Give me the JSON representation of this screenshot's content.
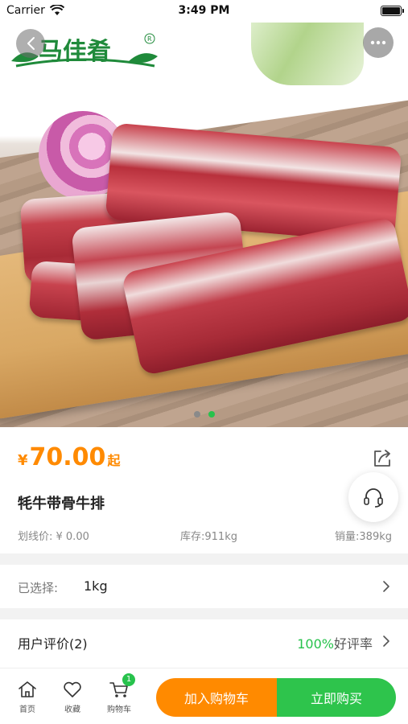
{
  "status_bar": {
    "carrier": "Carrier",
    "time": "3:49 PM"
  },
  "hero": {
    "brand_logo_text": "马佳肴",
    "brand_registered_mark": "R",
    "carousel_total": 2,
    "carousel_active_index": 1,
    "icons": {
      "back": "chevron-left-icon",
      "more": "ellipsis-icon"
    }
  },
  "product": {
    "price_currency": "¥",
    "price_value": "70.00",
    "price_suffix": "起",
    "name": "牦牛带骨牛排",
    "original_price": "划线价: ¥ 0.00",
    "stock": "库存:911kg",
    "sales": "销量:389kg",
    "icons": {
      "share": "share-icon",
      "customer_service": "headset-icon"
    }
  },
  "selection": {
    "label": "已选择:",
    "value": "1kg"
  },
  "reviews": {
    "label": "用户评价(2)",
    "rate_value": "100%",
    "rate_suffix": "好评率"
  },
  "bottom_bar": {
    "tabs": [
      {
        "label": "首页",
        "icon": "home-icon"
      },
      {
        "label": "收藏",
        "icon": "heart-icon"
      },
      {
        "label": "购物车",
        "icon": "cart-icon"
      }
    ],
    "cart_badge": "1",
    "add_to_cart": "加入购物车",
    "buy_now": "立即购买"
  },
  "colors": {
    "accent_orange": "#ff8a00",
    "accent_green": "#27c24c",
    "brand_green": "#1f8a3a"
  }
}
